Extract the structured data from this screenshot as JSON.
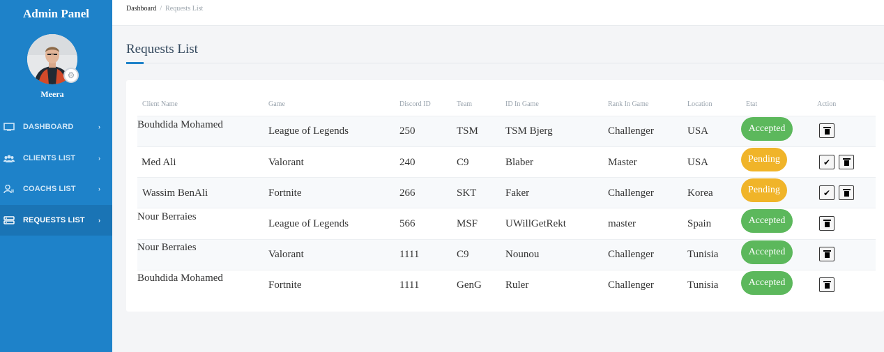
{
  "sidebar": {
    "brand": "Admin Panel",
    "user_name": "Meera",
    "items": [
      {
        "label": "DASHBOARD",
        "icon": "monitor-icon"
      },
      {
        "label": "CLIENTS LIST",
        "icon": "users-icon"
      },
      {
        "label": "COACHS LIST",
        "icon": "user-coach-icon"
      },
      {
        "label": "REQUESTS LIST",
        "icon": "server-list-icon",
        "active": true
      }
    ],
    "colors": {
      "background": "#1e82c9",
      "active": "#1a74b5"
    }
  },
  "breadcrumb": {
    "home": "Dashboard",
    "separator": "/",
    "current": "Requests List"
  },
  "page": {
    "title": "Requests List"
  },
  "table": {
    "headers": [
      "Client Name",
      "Game",
      "Discord ID",
      "Team",
      "ID In Game",
      "Rank In Game",
      "Location",
      "Etat",
      "Action"
    ],
    "rows": [
      {
        "client": "Bouhdida Mohamed",
        "game": "League of Legends",
        "discord": "250",
        "team": "TSM",
        "id_in_game": "TSM Bjerg",
        "rank": "Challenger",
        "location": "USA",
        "etat": "Accepted"
      },
      {
        "client": "Med Ali",
        "game": "Valorant",
        "discord": "240",
        "team": "C9",
        "id_in_game": "Blaber",
        "rank": "Master",
        "location": "USA",
        "etat": "Pending"
      },
      {
        "client": "Wassim BenAli",
        "game": "Fortnite",
        "discord": "266",
        "team": "SKT",
        "id_in_game": "Faker",
        "rank": "Challenger",
        "location": "Korea",
        "etat": "Pending"
      },
      {
        "client": "Nour Berraies",
        "game": "League of Legends",
        "discord": "566",
        "team": "MSF",
        "id_in_game": "UWillGetRekt",
        "rank": "master",
        "location": "Spain",
        "etat": "Accepted"
      },
      {
        "client": "Nour Berraies",
        "game": "Valorant",
        "discord": "1111",
        "team": "C9",
        "id_in_game": "Nounou",
        "rank": "Challenger",
        "location": "Tunisia",
        "etat": "Accepted"
      },
      {
        "client": "Bouhdida Mohamed",
        "game": "Fortnite",
        "discord": "1111",
        "team": "GenG",
        "id_in_game": "Ruler",
        "rank": "Challenger",
        "location": "Tunisia",
        "etat": "Accepted"
      }
    ],
    "status_colors": {
      "Accepted": "#5cb85c",
      "Pending": "#f0b429"
    },
    "actions": {
      "approve_icon": "checkmark-icon",
      "delete_icon": "trash-icon"
    }
  }
}
